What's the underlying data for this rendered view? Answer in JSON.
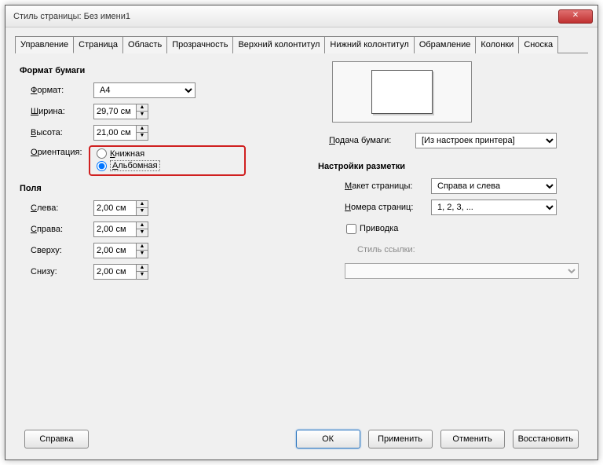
{
  "titlebar": {
    "title": "Стиль страницы: Без имени1"
  },
  "tabs": [
    "Управление",
    "Страница",
    "Область",
    "Прозрачность",
    "Верхний колонтитул",
    "Нижний колонтитул",
    "Обрамление",
    "Колонки",
    "Сноска"
  ],
  "paper": {
    "section": "Формат бумаги",
    "format_label": "Формат:",
    "format_value": "A4",
    "width_label": "Ширина:",
    "width_value": "29,70 см",
    "height_label": "Высота:",
    "height_value": "21,00 см",
    "orientation_label": "Ориентация:",
    "orientation_portrait": "Книжная",
    "orientation_landscape": "Альбомная"
  },
  "margins": {
    "section": "Поля",
    "left_label": "Слева:",
    "left_value": "2,00 см",
    "right_label": "Справа:",
    "right_value": "2,00 см",
    "top_label": "Сверху:",
    "top_value": "2,00 см",
    "bottom_label": "Снизу:",
    "bottom_value": "2,00 см"
  },
  "feed": {
    "label": "Подача бумаги:",
    "value": "[Из настроек принтера]"
  },
  "layout": {
    "section": "Настройки разметки",
    "page_layout_label": "Макет страницы:",
    "page_layout_value": "Справа и слева",
    "page_numbers_label": "Номера страниц:",
    "page_numbers_value": "1, 2, 3, ...",
    "register_label": "Приводка",
    "ref_style_label": "Стиль ссылки:",
    "ref_style_value": ""
  },
  "buttons": {
    "help": "Справка",
    "ok": "ОК",
    "apply": "Применить",
    "cancel": "Отменить",
    "reset": "Восстановить"
  }
}
